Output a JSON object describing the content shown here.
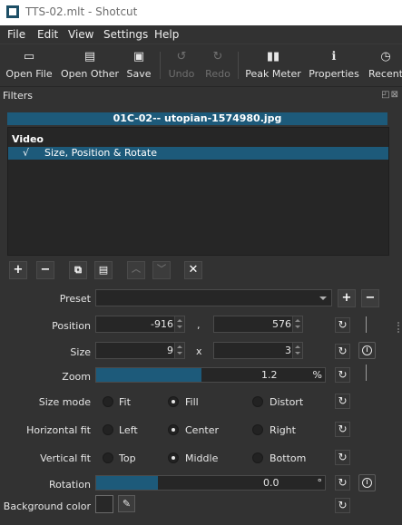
{
  "window": {
    "title": "TTS-02.mlt - Shotcut"
  },
  "menu": [
    "File",
    "Edit",
    "View",
    "Settings",
    "Help"
  ],
  "toolbar": {
    "open_file": "Open File",
    "open_other": "Open Other",
    "save": "Save",
    "undo": "Undo",
    "redo": "Redo",
    "peak_meter": "Peak Meter",
    "properties": "Properties",
    "recent": "Recent"
  },
  "panel": {
    "title": "Filters"
  },
  "clip": {
    "name": "01C-02-- utopian-1574980.jpg"
  },
  "filter_list": {
    "header": "Video",
    "items": [
      {
        "checked": "√",
        "name": "Size, Position & Rotate"
      }
    ]
  },
  "labels": {
    "preset": "Preset",
    "position": "Position",
    "size": "Size",
    "zoom": "Zoom",
    "size_mode": "Size mode",
    "horizontal_fit": "Horizontal fit",
    "vertical_fit": "Vertical fit",
    "rotation": "Rotation",
    "background_color": "Background color"
  },
  "values": {
    "position_x": "-916",
    "position_sep": ",",
    "position_y": "576",
    "size_w": "9",
    "size_sep": "x",
    "size_h": "3",
    "zoom": "1.2",
    "zoom_suffix": "%",
    "zoom_fraction": 0.46,
    "rotation": "0.0",
    "rotation_suffix": "°",
    "rotation_fraction": 0.27
  },
  "size_mode": {
    "options": [
      "Fit",
      "Fill",
      "Distort"
    ],
    "selected": "Fill"
  },
  "horizontal_fit": {
    "options": [
      "Left",
      "Center",
      "Right"
    ],
    "selected": "Center"
  },
  "vertical_fit": {
    "options": [
      "Top",
      "Middle",
      "Bottom"
    ],
    "selected": "Middle"
  },
  "icons": {
    "open_file": "folder-icon",
    "open_other": "open-other-icon",
    "save": "save-icon",
    "undo": "undo-icon",
    "redo": "redo-icon",
    "peak_meter": "peak-meter-icon",
    "properties": "info-icon",
    "recent": "clock-icon"
  },
  "colors": {
    "accent": "#1d5a7a",
    "background": "#323232",
    "background_color_value": "#282828"
  }
}
